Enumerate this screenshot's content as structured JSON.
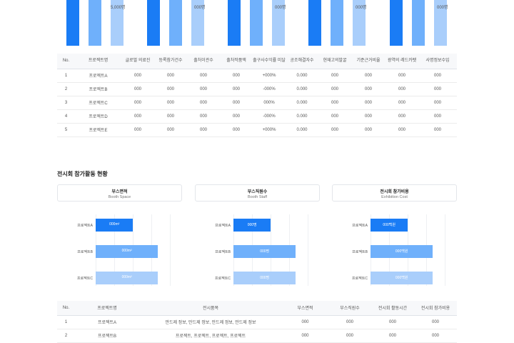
{
  "top_chart": {
    "group_labels": [
      "5,000명",
      "000명",
      "000명",
      "000명",
      "000명"
    ],
    "series_colors": [
      "#1a7cf5",
      "#6fb0fb",
      "#a9cefb"
    ]
  },
  "table1": {
    "headers": [
      "No.",
      "프로젝트명",
      "글로벌 의료진",
      "등록참가건수",
      "출처이관수",
      "출처작품액",
      "출구사수익률 미달",
      "공조해결자수",
      "현재고의발굴",
      "기준근거비율",
      "광역의 레드카펫",
      "사명정보수입"
    ],
    "rows": [
      [
        "1",
        "프로젝트A",
        "000",
        "000",
        "000",
        "000",
        "+000%",
        "0.000",
        "000",
        "000",
        "000",
        "000"
      ],
      [
        "2",
        "프로젝트B",
        "000",
        "000",
        "000",
        "000",
        "-000%",
        "0.000",
        "000",
        "000",
        "000",
        "000"
      ],
      [
        "3",
        "프로젝트C",
        "000",
        "000",
        "000",
        "000",
        "000%",
        "0.000",
        "000",
        "000",
        "000",
        "000"
      ],
      [
        "4",
        "프로젝트D",
        "000",
        "000",
        "000",
        "000",
        "-000%",
        "0.000",
        "000",
        "000",
        "000",
        "000"
      ],
      [
        "5",
        "프로젝트E",
        "000",
        "000",
        "000",
        "000",
        "+000%",
        "0.000",
        "000",
        "000",
        "000",
        "000"
      ]
    ]
  },
  "section": {
    "title": "전시회 참가활동 현황"
  },
  "cards": [
    {
      "title": "부스면적",
      "subtitle": "Booth Space"
    },
    {
      "title": "부스직원수",
      "subtitle": "Booth Staff"
    },
    {
      "title": "전시회 참가비용",
      "subtitle": "Exhibition Cost"
    }
  ],
  "chart_data": [
    {
      "type": "bar",
      "categories": [
        "프로젝트A",
        "프로젝트B",
        "프로젝트C"
      ],
      "values": [
        0.45,
        0.75,
        0.75
      ],
      "data_labels": [
        "000m²",
        "000m²",
        "000m²"
      ]
    },
    {
      "type": "bar",
      "categories": [
        "프로젝트A",
        "프로젝트B",
        "프로젝트C"
      ],
      "values": [
        0.45,
        0.75,
        0.75
      ],
      "data_labels": [
        "000명",
        "000명",
        "000명"
      ]
    },
    {
      "type": "bar",
      "categories": [
        "프로젝트A",
        "프로젝트B",
        "프로젝트C"
      ],
      "values": [
        0.45,
        0.75,
        0.75
      ],
      "data_labels": [
        "000백원",
        "000백원",
        "000백원"
      ]
    }
  ],
  "table2": {
    "headers": [
      "No.",
      "프로젝트명",
      "전시품목",
      "부스면적",
      "부스직원수",
      "전시회 활동시간",
      "전시회 참가비용"
    ],
    "rows": [
      [
        "1",
        "프로젝트A",
        "만드제 정보, 만드제 정보, 만드제 정보, 만드제 정보",
        "000",
        "000",
        "000",
        "000"
      ],
      [
        "2",
        "프로젝트B",
        "프로젝트, 프로젝트, 프로젝트, 프로젝트",
        "000",
        "000",
        "000",
        "000"
      ]
    ]
  }
}
